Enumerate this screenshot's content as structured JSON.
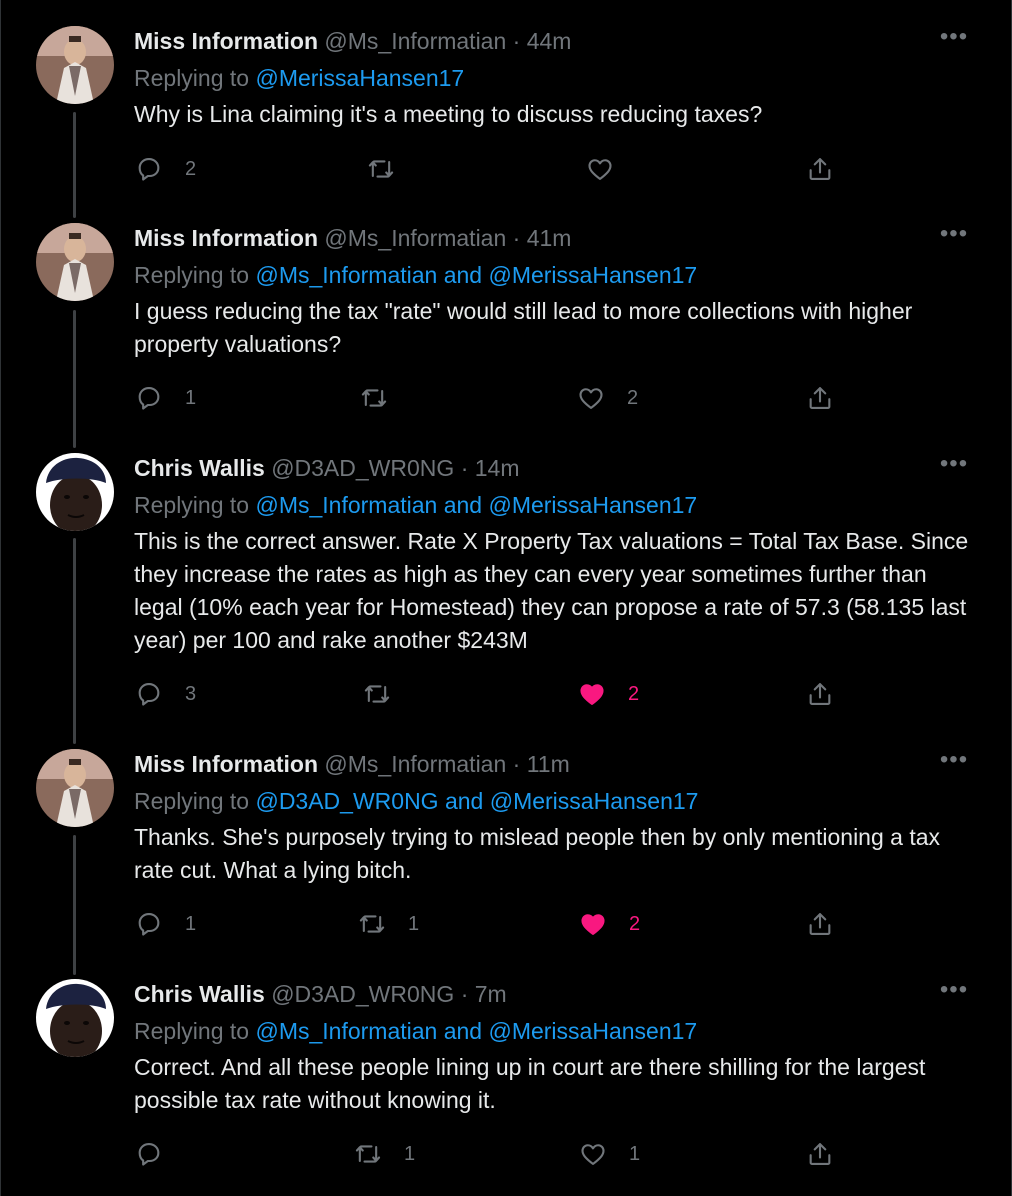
{
  "thread": [
    {
      "name": "Miss Information",
      "handle": "@Ms_Informatian",
      "sep": "·",
      "time": "44m",
      "more": "•••",
      "replying_prefix": "Replying to ",
      "replying_mentions": "@MerissaHansen17",
      "text": "Why is Lina claiming it's a meeting to discuss reducing taxes?",
      "avatar": "avatar-miss-information",
      "replies": "2",
      "retweets": "",
      "likes": "",
      "liked": false
    },
    {
      "name": "Miss Information",
      "handle": "@Ms_Informatian",
      "sep": "·",
      "time": "41m",
      "more": "•••",
      "replying_prefix": "Replying to ",
      "replying_mentions": "@Ms_Informatian and @MerissaHansen17",
      "text": "I guess reducing the tax \"rate\" would still lead to more collections with higher property valuations?",
      "avatar": "avatar-miss-information",
      "replies": "1",
      "retweets": "",
      "likes": "2",
      "liked": false
    },
    {
      "name": "Chris Wallis",
      "handle": "@D3AD_WR0NG",
      "sep": "·",
      "time": "14m",
      "more": "•••",
      "replying_prefix": "Replying to ",
      "replying_mentions": "@Ms_Informatian and @MerissaHansen17",
      "text": "This is the correct answer.  Rate X Property Tax valuations = Total Tax Base.  Since they increase the rates as high as they can every year sometimes further than legal (10% each year for Homestead) they can propose a rate of 57.3 (58.135 last year) per 100 and rake another $243M",
      "avatar": "avatar-chris-wallis",
      "replies": "3",
      "retweets": "",
      "likes": "2",
      "liked": true
    },
    {
      "name": "Miss Information",
      "handle": "@Ms_Informatian",
      "sep": "·",
      "time": "11m",
      "more": "•••",
      "replying_prefix": "Replying to ",
      "replying_mentions": "@D3AD_WR0NG and @MerissaHansen17",
      "text": "Thanks. She's purposely trying to mislead people then by only mentioning a tax rate cut. What a lying bitch.",
      "avatar": "avatar-miss-information",
      "replies": "1",
      "retweets": "1",
      "likes": "2",
      "liked": true
    },
    {
      "name": "Chris Wallis",
      "handle": "@D3AD_WR0NG",
      "sep": "·",
      "time": "7m",
      "more": "•••",
      "replying_prefix": "Replying to ",
      "replying_mentions": "@Ms_Informatian and @MerissaHansen17",
      "text": "Correct.  And all these people lining up in court are there shilling for the largest possible tax rate without knowing it.",
      "avatar": "avatar-chris-wallis",
      "replies": "",
      "retweets": "1",
      "likes": "1",
      "liked": false
    }
  ],
  "colors": {
    "background": "#000000",
    "text": "#e7e9ea",
    "muted": "#71767b",
    "link": "#1d9bf0",
    "like": "#f91880",
    "thread_line": "#3e4144"
  }
}
